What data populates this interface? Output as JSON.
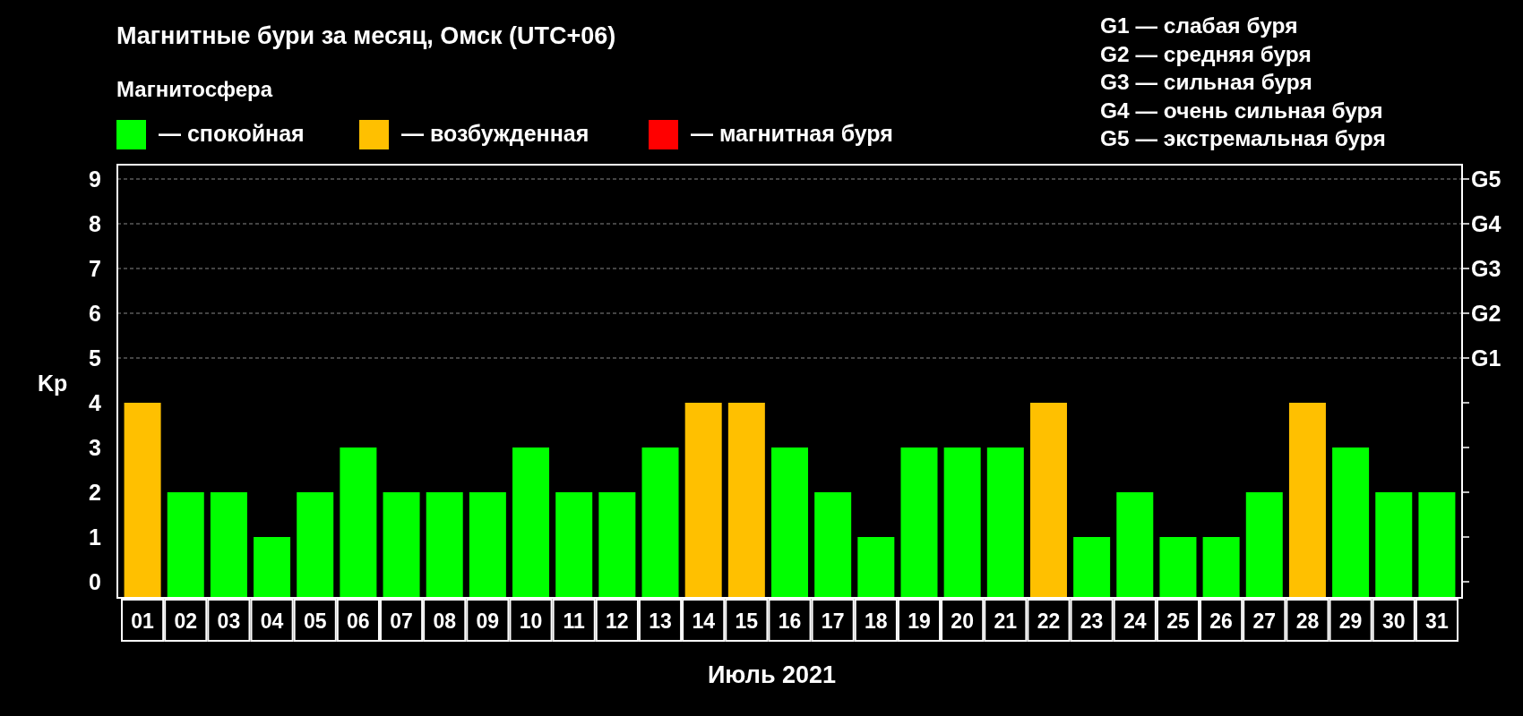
{
  "title": "Магнитные бури за месяц, Омск (UTC+06)",
  "legend": {
    "title": "Магнитосфера",
    "items": [
      {
        "label": "— спокойная",
        "color": "#00ff00"
      },
      {
        "label": "— возбужденная",
        "color": "#ffc000"
      },
      {
        "label": "— магнитная буря",
        "color": "#ff0000"
      }
    ]
  },
  "scale": [
    "G1 — слабая буря",
    "G2 — средняя буря",
    "G3 — сильная буря",
    "G4 — очень сильная буря",
    "G5 — экстремальная буря"
  ],
  "right_axis_labels": [
    "G5",
    "G4",
    "G3",
    "G2",
    "G1"
  ],
  "chart_data": {
    "type": "bar",
    "xlabel": "Июль 2021",
    "ylabel": "Kp",
    "grid": true,
    "categories": [
      "01",
      "02",
      "03",
      "04",
      "05",
      "06",
      "07",
      "08",
      "09",
      "10",
      "11",
      "12",
      "13",
      "14",
      "15",
      "16",
      "17",
      "18",
      "19",
      "20",
      "21",
      "22",
      "23",
      "24",
      "25",
      "26",
      "27",
      "28",
      "29",
      "30",
      "31"
    ],
    "series": [
      {
        "color": "#00ff00",
        "values": [
          null,
          2,
          2,
          1,
          2,
          3,
          2,
          2,
          2,
          3,
          2,
          2,
          3,
          null,
          null,
          3,
          2,
          1,
          3,
          3,
          3,
          null,
          1,
          2,
          1,
          1,
          2,
          null,
          3,
          2,
          2
        ]
      },
      {
        "color": "#ffc000",
        "values": [
          4,
          null,
          null,
          null,
          null,
          null,
          null,
          null,
          null,
          null,
          null,
          null,
          null,
          4,
          4,
          null,
          null,
          null,
          null,
          null,
          null,
          4,
          null,
          null,
          null,
          null,
          null,
          4,
          null,
          null,
          null
        ]
      }
    ],
    "ylim": [
      0,
      9
    ],
    "yticks": [
      0,
      1,
      2,
      3,
      4,
      5,
      6,
      7,
      8,
      9
    ]
  }
}
